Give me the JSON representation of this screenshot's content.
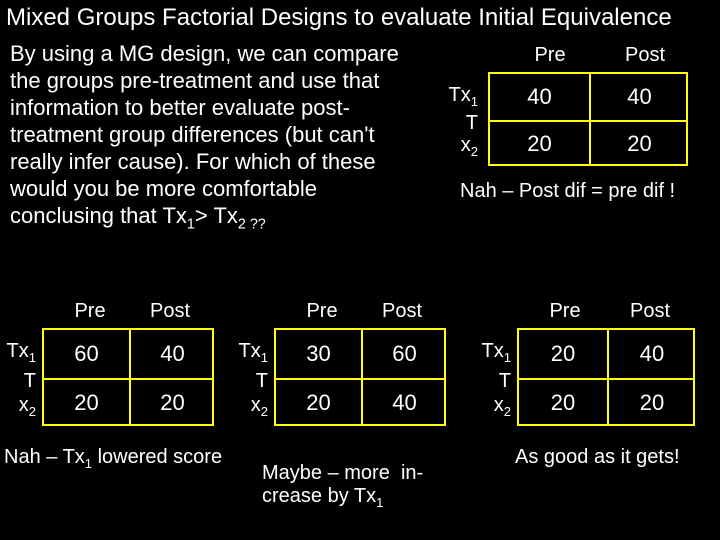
{
  "title": "Mixed Groups Factorial Designs to evaluate Initial Equivalence",
  "body_text_html": "By using a MG design, we can compare the groups pre-treatment and use that information to better evaluate post-treatment group differences (but can't really infer cause).  For which of these would you be more comfortable conclusing that Tx<sub>1</sub>> Tx<sub>2 ??</sub>",
  "headers": {
    "pre": "Pre",
    "post": "Post"
  },
  "row_labels": {
    "tx1": "Tx<sub>1</sub>",
    "T": "T",
    "x2": "x<sub>2</sub>"
  },
  "tables": {
    "top": {
      "cells": [
        [
          "40",
          "40"
        ],
        [
          "20",
          "20"
        ]
      ],
      "caption": "Nah – Post dif = pre dif !"
    },
    "bl": {
      "cells": [
        [
          "60",
          "40"
        ],
        [
          "20",
          "20"
        ]
      ],
      "caption_html": "Nah – Tx<sub>1</sub> lowered score"
    },
    "bc": {
      "cells": [
        [
          "30",
          "60"
        ],
        [
          "20",
          "40"
        ]
      ],
      "caption_html": "Maybe – more &nbsp;in-<br>crease by Tx<sub>1</sub>"
    },
    "br": {
      "cells": [
        [
          "20",
          "40"
        ],
        [
          "20",
          "20"
        ]
      ],
      "caption": "As good as it gets!"
    }
  }
}
